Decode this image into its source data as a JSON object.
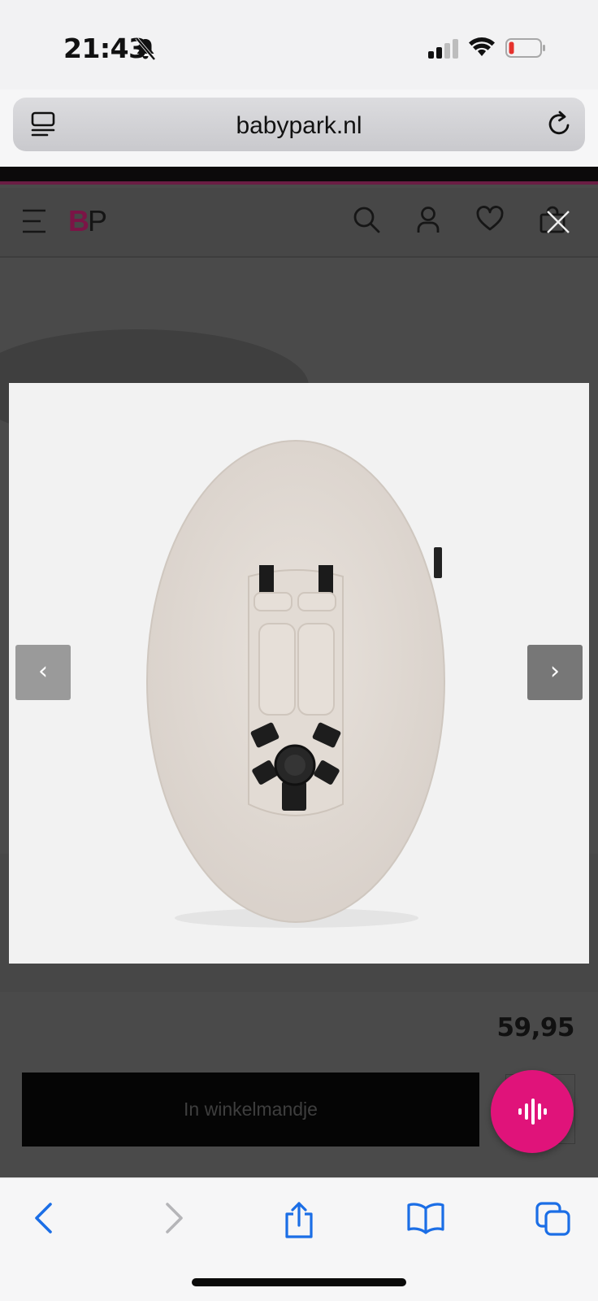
{
  "status_bar": {
    "time": "21:43",
    "icons": [
      "bell-slash-icon",
      "cellular-signal-icon",
      "wifi-icon",
      "battery-low-icon"
    ]
  },
  "browser": {
    "url": "babypark.nl",
    "icons": [
      "reader-mode-icon",
      "reload-icon"
    ]
  },
  "site_header": {
    "logo_b": "B",
    "logo_p": "P",
    "icons": [
      "menu-icon",
      "search-icon",
      "account-icon",
      "wishlist-heart-icon",
      "shopping-bag-icon"
    ],
    "accent_color": "#7b1446"
  },
  "gallery": {
    "prev_label": "‹",
    "next_label": "›",
    "close_icon": "close-icon"
  },
  "product": {
    "price": "59,95",
    "add_to_cart_label": "In winkelmandje"
  },
  "voice_button": {
    "icon": "voice-waveform-icon",
    "color": "#e0137a"
  },
  "toolbar": {
    "icons": [
      "back-icon",
      "forward-icon",
      "share-icon",
      "bookmarks-icon",
      "tabs-icon"
    ]
  }
}
